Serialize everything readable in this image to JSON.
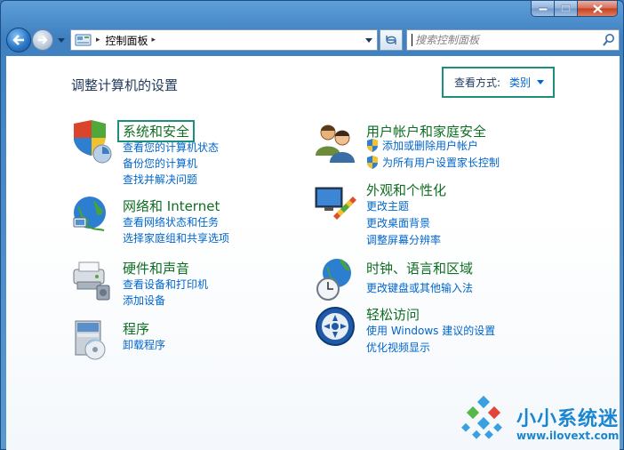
{
  "window": {
    "controls": {
      "minimize": "minimize",
      "maximize": "maximize",
      "close": "close"
    }
  },
  "nav": {
    "back": "back",
    "forward": "forward",
    "address": {
      "separator": "▸",
      "text": "控制面板",
      "trailing_separator": "▸"
    },
    "search": {
      "placeholder": "搜索控制面板"
    }
  },
  "main": {
    "title": "调整计算机的设置",
    "view_by": {
      "label": "查看方式:",
      "value": "类别"
    }
  },
  "categories": [
    {
      "title": "系统和安全",
      "icon": "system-security-icon",
      "links": [
        "查看您的计算机状态",
        "备份您的计算机",
        "查找并解决问题"
      ]
    },
    {
      "title": "网络和 Internet",
      "icon": "network-internet-icon",
      "links": [
        "查看网络状态和任务",
        "选择家庭组和共享选项"
      ]
    },
    {
      "title": "硬件和声音",
      "icon": "hardware-sound-icon",
      "links": [
        "查看设备和打印机",
        "添加设备"
      ]
    },
    {
      "title": "程序",
      "icon": "programs-icon",
      "links": [
        "卸载程序"
      ]
    },
    {
      "title": "用户帐户和家庭安全",
      "icon": "user-accounts-icon",
      "links": [
        "添加或删除用户帐户",
        "为所有用户设置家长控制"
      ]
    },
    {
      "title": "外观和个性化",
      "icon": "appearance-icon",
      "links": [
        "更改主题",
        "更改桌面背景",
        "调整屏幕分辨率"
      ]
    },
    {
      "title": "时钟、语言和区域",
      "icon": "clock-language-icon",
      "links": [
        "更改键盘或其他输入法"
      ]
    },
    {
      "title": "轻松访问",
      "icon": "ease-of-access-icon",
      "links": [
        "使用 Windows 建议的设置",
        "优化视频显示"
      ]
    }
  ],
  "watermark": {
    "name": "小小系统迷",
    "url": "www.ilovext.com"
  },
  "colors": {
    "link": "#0066cc",
    "category_title": "#0e6e22",
    "highlight_box": "#1b8e7e",
    "frame": "#3f80c1"
  }
}
